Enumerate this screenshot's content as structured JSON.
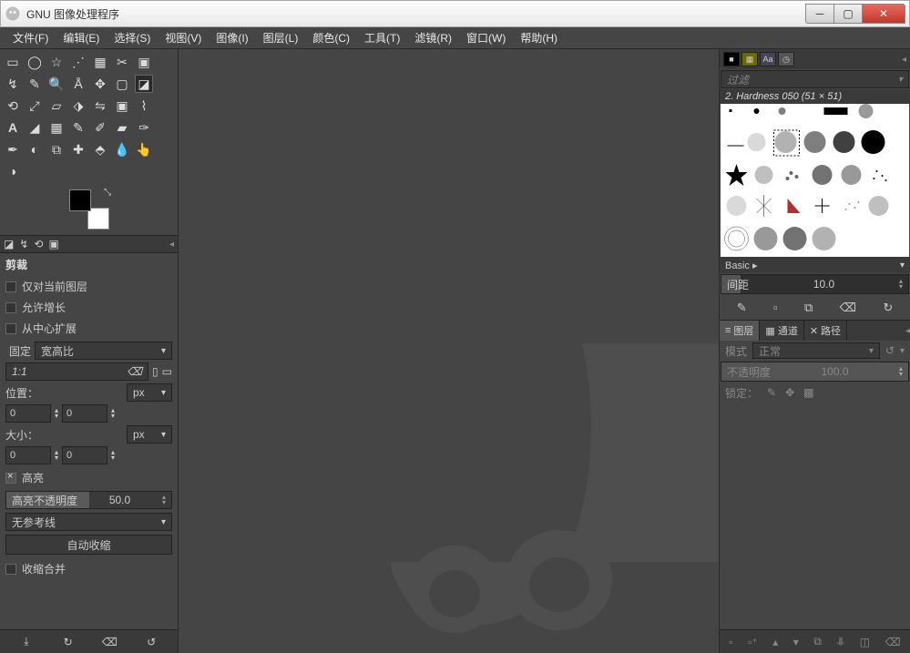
{
  "title": "GNU 图像处理程序",
  "menu": [
    "文件(F)",
    "编辑(E)",
    "选择(S)",
    "视图(V)",
    "图像(I)",
    "图层(L)",
    "颜色(C)",
    "工具(T)",
    "滤镜(R)",
    "窗口(W)",
    "帮助(H)"
  ],
  "tool_options": {
    "heading": "剪裁",
    "c1": "仅对当前图层",
    "c2": "允许增长",
    "c3": "从中心扩展",
    "fixed": "固定",
    "aspect": "宽高比",
    "ratio": "1:1",
    "pos_label": "位置：",
    "size_label": "大小：",
    "px": "px",
    "zero": "0",
    "highlight": "高亮",
    "highlight_opacity": "高亮不透明度",
    "highlight_val": "50.0",
    "guides": "无参考线",
    "auto_shrink": "自动收缩",
    "shrink_merge": "收缩合并"
  },
  "brushes": {
    "filter": "过滤",
    "current": "2. Hardness 050 (51 × 51)",
    "preset": "Basic ▸",
    "spacing_label": "间距",
    "spacing_val": "10.0"
  },
  "layers": {
    "t1": "图层",
    "t2": "通道",
    "t3": "路径",
    "mode_label": "模式",
    "mode_val": "正常",
    "opacity_label": "不透明度",
    "opacity_val": "100.0",
    "lock_label": "锁定："
  }
}
